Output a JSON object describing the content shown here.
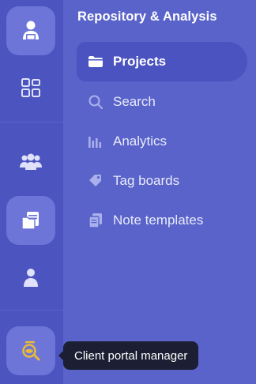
{
  "panel": {
    "title": "Repository & Analysis"
  },
  "nav": {
    "items": [
      {
        "label": "Projects",
        "icon": "folder-icon",
        "active": true
      },
      {
        "label": "Search",
        "icon": "search-icon",
        "active": false
      },
      {
        "label": "Analytics",
        "icon": "bar-chart-icon",
        "active": false
      },
      {
        "label": "Tag boards",
        "icon": "tag-icon",
        "active": false
      },
      {
        "label": "Note templates",
        "icon": "notes-icon",
        "active": false
      }
    ]
  },
  "rail": {
    "items": [
      {
        "icon": "user-laptop-icon",
        "highlighted": true
      },
      {
        "icon": "grid-icon",
        "highlighted": false
      },
      {
        "icon": "team-icon",
        "highlighted": false
      },
      {
        "icon": "documents-icon",
        "highlighted": true
      },
      {
        "icon": "person-icon",
        "highlighted": false
      },
      {
        "icon": "client-portal-icon",
        "highlighted": true
      }
    ]
  },
  "tooltip": {
    "text": "Client portal manager"
  },
  "colors": {
    "rail_bg": "#4b54bf",
    "panel_bg": "#5963c9",
    "active_bg": "#4a53bf",
    "highlight_btn": "#6d75d8",
    "accent_gold": "#e8b93a",
    "tooltip_bg": "#1c1f33"
  }
}
